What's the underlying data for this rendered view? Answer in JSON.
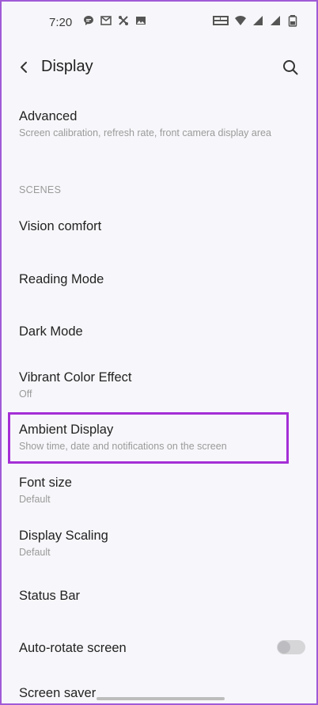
{
  "status": {
    "time": "7:20"
  },
  "header": {
    "title": "Display"
  },
  "list": {
    "advanced": {
      "title": "Advanced",
      "subtitle": "Screen calibration, refresh rate, front camera display area"
    },
    "section_scenes": "SCENES",
    "vision_comfort": {
      "title": "Vision comfort"
    },
    "reading_mode": {
      "title": "Reading Mode"
    },
    "dark_mode": {
      "title": "Dark Mode"
    },
    "vibrant_color": {
      "title": "Vibrant Color Effect",
      "subtitle": "Off"
    },
    "ambient_display": {
      "title": "Ambient Display",
      "subtitle": "Show time, date and notifications on the screen"
    },
    "font_size": {
      "title": "Font size",
      "subtitle": "Default"
    },
    "display_scaling": {
      "title": "Display Scaling",
      "subtitle": "Default"
    },
    "status_bar": {
      "title": "Status Bar"
    },
    "auto_rotate": {
      "title": "Auto-rotate screen",
      "enabled": false
    },
    "screen_saver": {
      "title": "Screen saver"
    }
  },
  "icons": {
    "back": "arrow-back-icon",
    "search": "search-icon"
  },
  "colors": {
    "highlight": "#a52fd6",
    "frame": "#a05ad6"
  }
}
